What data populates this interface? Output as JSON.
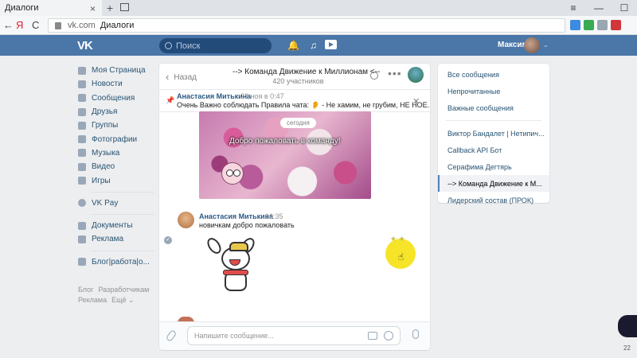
{
  "browser": {
    "tab_title": "Диалоги",
    "tab_close": "×",
    "tab_new": "+",
    "window_buttons": [
      "≡",
      "—",
      "☐"
    ],
    "nav": [
      "←",
      "Я",
      "C"
    ],
    "address_domain": "vk.com",
    "address_page": "Диалоги",
    "ext_colors": [
      "#3d8be0",
      "#3aaa53",
      "#9aa7b2",
      "#d0363a"
    ]
  },
  "header": {
    "logo": "VK",
    "search_placeholder": "Поиск",
    "user_name": "Максим",
    "chevron": "⌄",
    "bell": "🔔",
    "note": "♫"
  },
  "left_menu": {
    "items": [
      {
        "label": "Моя Страница",
        "icon": "home-icon"
      },
      {
        "label": "Новости",
        "icon": "news-icon"
      },
      {
        "label": "Сообщения",
        "icon": "messages-icon"
      },
      {
        "label": "Друзья",
        "icon": "friends-icon"
      },
      {
        "label": "Группы",
        "icon": "groups-icon"
      },
      {
        "label": "Фотографии",
        "icon": "photos-icon"
      },
      {
        "label": "Музыка",
        "icon": "music-icon"
      },
      {
        "label": "Видео",
        "icon": "video-icon"
      },
      {
        "label": "Игры",
        "icon": "games-icon"
      }
    ],
    "items2": [
      {
        "label": "VK Pay",
        "icon": "vkpay-icon"
      }
    ],
    "items3": [
      {
        "label": "Документы",
        "icon": "docs-icon"
      },
      {
        "label": "Реклама",
        "icon": "ads-icon"
      }
    ],
    "items4": [
      {
        "label": "Блог|работа|о...",
        "icon": "blog-icon"
      }
    ],
    "footer": [
      "Блог",
      "Разработчикам",
      "Реклама",
      "Ещё ⌄"
    ]
  },
  "chat": {
    "back_label": "Назад",
    "back_chevron": "‹",
    "title": "--> Команда Движение к Миллионам <--",
    "subtitle": "420 участников",
    "more": "•••",
    "pinned": {
      "icon": "📌",
      "author": "Анастасия Митькина",
      "date": "22 ноя в 0:47",
      "text": "Очень Важно соблюдать Правила чата: 👂 - Не хамим, не грубим, НЕ НОЕ...",
      "close": "✕"
    },
    "date_pill": "сегодня",
    "photo_caption": "Добро пожаловать в команду!",
    "message": {
      "author": "Анастасия Митькина",
      "time": "16:35",
      "text": "новичкам добро пожаловать"
    },
    "check": "✓",
    "stars": "★ ★",
    "cursor": "☝",
    "composer_placeholder": "Напишите сообщение..."
  },
  "right_list": {
    "top": [
      "Все сообщения",
      "Непрочитанные",
      "Важные сообщения"
    ],
    "chats": [
      "Виктор Бандалет | Нетипич...",
      "Callback API Бот",
      "Серафима Дегтярь",
      "--> Команда Движение к М...",
      "Лидерский состав (ПРОК)"
    ],
    "active_index": 3
  },
  "side_count": "22"
}
